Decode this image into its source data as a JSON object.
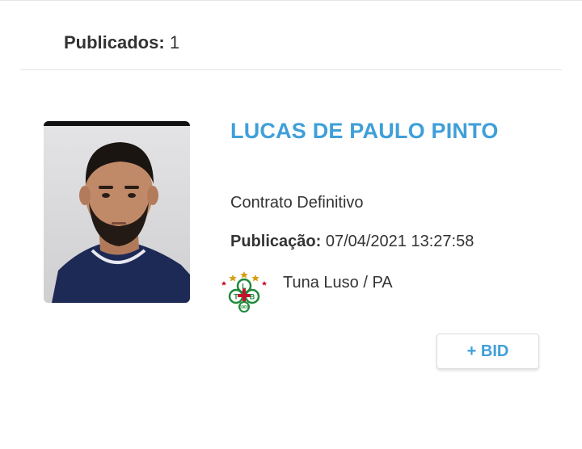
{
  "header": {
    "count_label": "Publicados:",
    "count_value": "1"
  },
  "player": {
    "name": "LUCAS DE PAULO PINTO",
    "contract_type": "Contrato Definitivo",
    "publication_label": "Publicação:",
    "publication_datetime": "07/04/2021 13:27:58",
    "club": "Tuna Luso / PA",
    "club_logo_text": {
      "top": "L",
      "left": "T",
      "right": "B",
      "year": "1903"
    }
  },
  "actions": {
    "bid_label": "+ BID"
  },
  "colors": {
    "accent": "#3f9fd9",
    "text": "#333333",
    "club_green": "#1f8a3b",
    "club_red": "#c8102e"
  }
}
